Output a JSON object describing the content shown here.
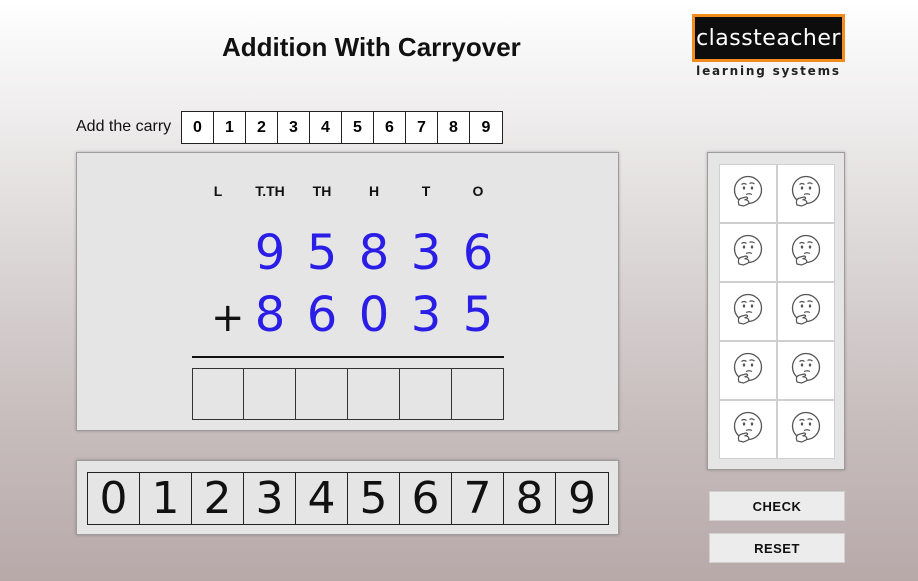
{
  "title": "Addition With Carryover",
  "logo": {
    "name": "classteacher",
    "tagline": "learning systems"
  },
  "carry": {
    "label": "Add the carry",
    "digits": [
      "0",
      "1",
      "2",
      "3",
      "4",
      "5",
      "6",
      "7",
      "8",
      "9"
    ]
  },
  "problem": {
    "columns": [
      "L",
      "T.TH",
      "TH",
      "H",
      "T",
      "O"
    ],
    "first_number": [
      "9",
      "5",
      "8",
      "3",
      "6"
    ],
    "operator": "+",
    "second_number": [
      "8",
      "6",
      "0",
      "3",
      "5"
    ],
    "answer_slots": 6
  },
  "digit_tray": [
    "0",
    "1",
    "2",
    "3",
    "4",
    "5",
    "6",
    "7",
    "8",
    "9"
  ],
  "feedback_faces": {
    "count": 10,
    "icon": "thinking-face-icon"
  },
  "buttons": {
    "check": "CHECK",
    "reset": "RESET"
  },
  "colors": {
    "digit": "#2a1ee6",
    "logo_border": "#f28c1e",
    "logo_bg": "#0d0d0d"
  }
}
